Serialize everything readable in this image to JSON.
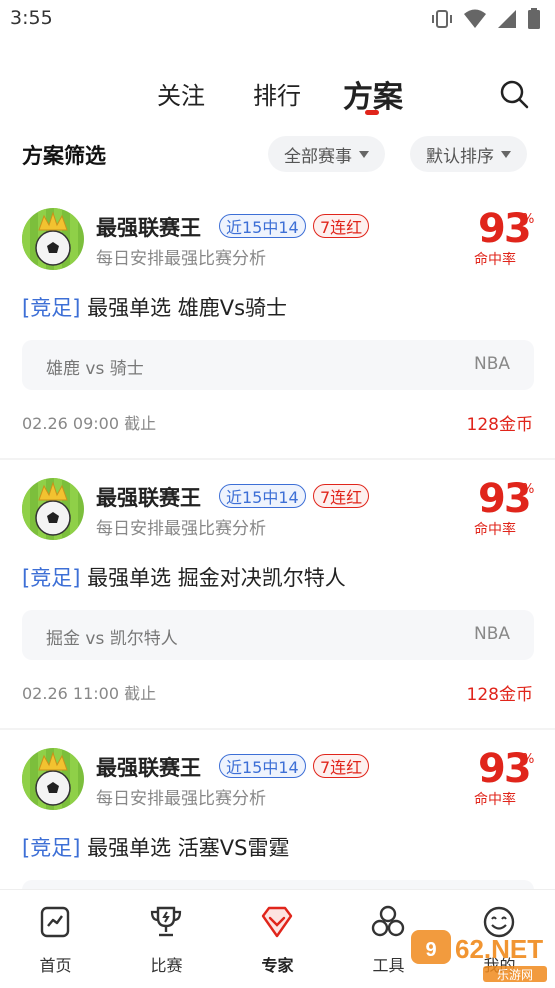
{
  "status_bar": {
    "time": "3:55",
    "icons": [
      "vibrate-icon",
      "wifi-icon",
      "signal-icon",
      "battery-icon"
    ]
  },
  "top_tabs": {
    "items": [
      {
        "label": "关注",
        "active": false
      },
      {
        "label": "排行",
        "active": false
      },
      {
        "label": "方案",
        "active": true
      }
    ],
    "search_icon": "search-icon"
  },
  "filter": {
    "title": "方案筛选",
    "event_filter": "全部赛事",
    "sort_filter": "默认排序"
  },
  "cards": [
    {
      "expert_name": "最强联赛王",
      "badge_recent": "近15中14",
      "badge_streak": "7连红",
      "description": "每日安排最强比赛分析",
      "hit_rate": "93",
      "hit_rate_unit": "%",
      "hit_rate_label": "命中率",
      "tag": "[竞足]",
      "title": "最强单选 雄鹿Vs骑士",
      "match": "雄鹿 vs 骑士",
      "league": "NBA",
      "deadline": "02.26 09:00 截止",
      "price": "128金币"
    },
    {
      "expert_name": "最强联赛王",
      "badge_recent": "近15中14",
      "badge_streak": "7连红",
      "description": "每日安排最强比赛分析",
      "hit_rate": "93",
      "hit_rate_unit": "%",
      "hit_rate_label": "命中率",
      "tag": "[竞足]",
      "title": "最强单选 掘金对决凯尔特人",
      "match": "掘金 vs 凯尔特人",
      "league": "NBA",
      "deadline": "02.26 11:00 截止",
      "price": "128金币"
    },
    {
      "expert_name": "最强联赛王",
      "badge_recent": "近15中14",
      "badge_streak": "7连红",
      "description": "每日安排最强比赛分析",
      "hit_rate": "93",
      "hit_rate_unit": "%",
      "hit_rate_label": "命中率",
      "tag": "[竞足]",
      "title": "最强单选 活塞VS雷霆"
    }
  ],
  "bottom_nav": [
    {
      "label": "首页",
      "icon": "home-chart-icon",
      "active": false
    },
    {
      "label": "比赛",
      "icon": "trophy-icon",
      "active": false
    },
    {
      "label": "专家",
      "icon": "expert-diamond-icon",
      "active": true
    },
    {
      "label": "工具",
      "icon": "tools-icon",
      "active": false
    },
    {
      "label": "我的",
      "icon": "smile-icon",
      "active": false
    }
  ],
  "watermark": {
    "text": "962.NET",
    "sub": "乐游网"
  },
  "colors": {
    "accent_red": "#e0251b",
    "tag_blue": "#3d6fd6"
  }
}
